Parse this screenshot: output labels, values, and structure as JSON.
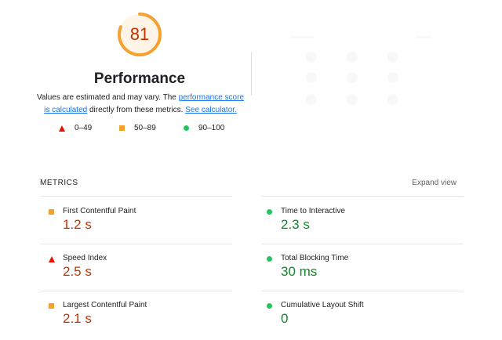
{
  "performance": {
    "score": "81",
    "score_fraction": 0.81,
    "gauge_color": "#f4a12f",
    "title": "Performance",
    "desc_prefix": "Values are estimated and may vary. The ",
    "desc_link1": "performance score is calculated",
    "desc_middle": " directly from these metrics. ",
    "desc_link2": "See calculator."
  },
  "legend": [
    {
      "shape": "triangle-icon",
      "color": "#eb0f00",
      "label": "0–49"
    },
    {
      "shape": "square-icon",
      "color": "#f4a12f",
      "label": "50–89"
    },
    {
      "shape": "circle-icon",
      "color": "#22c55e",
      "label": "90–100"
    }
  ],
  "metrics_section": {
    "header": "METRICS",
    "expand_label": "Expand view"
  },
  "metrics": [
    {
      "name": "First Contentful Paint",
      "value": "1.2 s",
      "status": "average",
      "icon": "square-icon",
      "color": "#f4a12f"
    },
    {
      "name": "Time to Interactive",
      "value": "2.3 s",
      "status": "pass",
      "icon": "circle-icon",
      "color": "#22c55e"
    },
    {
      "name": "Speed Index",
      "value": "2.5 s",
      "status": "fail",
      "icon": "triangle-icon",
      "color": "#eb0f00"
    },
    {
      "name": "Total Blocking Time",
      "value": "30 ms",
      "status": "pass",
      "icon": "circle-icon",
      "color": "#22c55e"
    },
    {
      "name": "Largest Contentful Paint",
      "value": "2.1 s",
      "status": "average",
      "icon": "square-icon",
      "color": "#f4a12f"
    },
    {
      "name": "Cumulative Layout Shift",
      "value": "0",
      "status": "pass",
      "icon": "circle-icon",
      "color": "#22c55e"
    }
  ]
}
